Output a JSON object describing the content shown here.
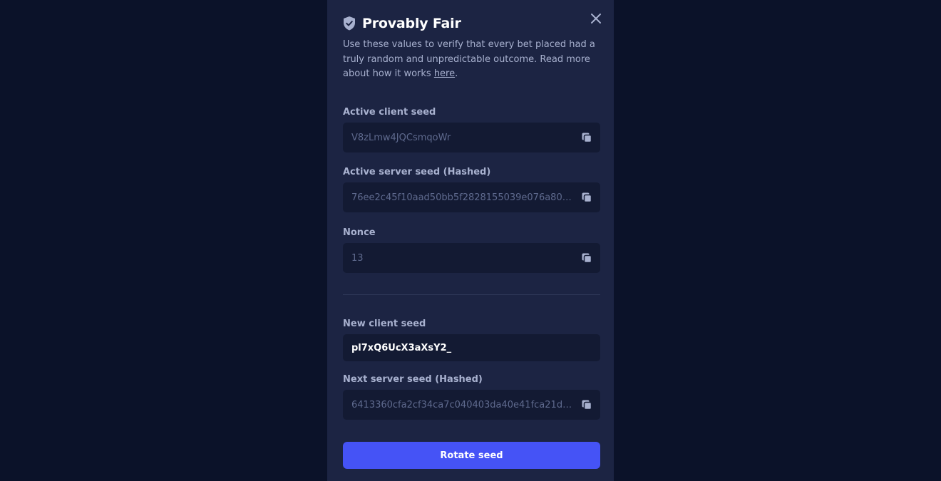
{
  "modal": {
    "title": "Provably Fair",
    "description_pre": "Use these values to verify that every bet placed had a truly random and unpredictable outcome. Read more about how it works ",
    "description_link": "here",
    "description_post": "."
  },
  "fields": {
    "active_client_seed": {
      "label": "Active client seed",
      "value": "V8zLmw4JQCsmqoWr"
    },
    "active_server_seed": {
      "label": "Active server seed (Hashed)",
      "value": "76ee2c45f10aad50bb5f2828155039e076a807bc…"
    },
    "nonce": {
      "label": "Nonce",
      "value": "13"
    },
    "new_client_seed": {
      "label": "New client seed",
      "value": "pl7xQ6UcX3aXsY2_"
    },
    "next_server_seed": {
      "label": "Next server seed (Hashed)",
      "value": "6413360cfa2cf34ca7c040403da40e41fca21d28a…"
    }
  },
  "actions": {
    "rotate_label": "Rotate seed"
  },
  "icons": {
    "header": "shield-check-icon",
    "close": "close-icon",
    "copy": "copy-icon"
  },
  "colors": {
    "background": "#0b1229",
    "modal": "#1c2443",
    "field": "#131a33",
    "accent": "#4553f6"
  }
}
